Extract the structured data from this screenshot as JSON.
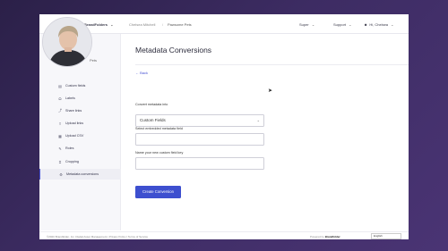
{
  "topbar": {
    "brand": "BrandFolders",
    "breadcrumb_user": "Chelsea Mitchell",
    "breadcrumb_separator": "/",
    "breadcrumb_current": "Pawsome Pets",
    "super_label": "Super",
    "support_label": "Support",
    "user_label": "Hi, Chelsea",
    "chevron": "⌄",
    "user_icon": "person-icon"
  },
  "sidebar": {
    "top_label": "Pets",
    "items": [
      {
        "label": "Custom fields",
        "icon": "▤"
      },
      {
        "label": "Labels",
        "icon": "⬭"
      },
      {
        "label": "Share links",
        "icon": "⤴"
      },
      {
        "label": "Upload links",
        "icon": "⇪"
      },
      {
        "label": "Upload CSV",
        "icon": "▦"
      },
      {
        "label": "Roles",
        "icon": "✎"
      },
      {
        "label": "Cropping",
        "icon": "⌗"
      },
      {
        "label": "Metadata conversions",
        "icon": "⚙"
      }
    ],
    "active_index": 7
  },
  "main": {
    "title": "Metadata Conversions",
    "back_label": "← Back",
    "convert_label": "Convert metadata into",
    "convert_value": "Custom Fields",
    "embedded_label": "Select embedded metadata field",
    "embedded_value": "",
    "key_label": "Name your new custom field key",
    "key_value": "",
    "create_button": "Create Conversion"
  },
  "footer": {
    "copyright": "©2020 Brandfolder, Inc. Digital Asset Management | Privacy Policy | Terms of Service",
    "powered_by": "Powered by",
    "powered_brand": "Brandfolder",
    "language": "English"
  },
  "colors": {
    "accent": "#3d4fcf",
    "background_gradient_start": "#2b2048",
    "background_gradient_end": "#4a3474"
  }
}
